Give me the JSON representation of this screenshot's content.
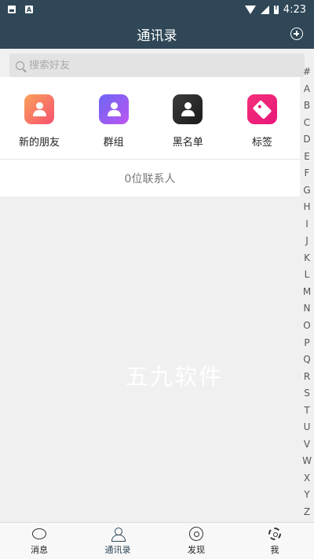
{
  "status_bar": {
    "left_icons": [
      "image-icon",
      "a-icon"
    ],
    "right_icons": [
      "wifi-icon",
      "signal-icon",
      "battery-alert-icon"
    ],
    "time": "4:23"
  },
  "header": {
    "title": "通讯录",
    "action_icon": "add-circle-icon"
  },
  "search": {
    "placeholder": "搜索好友",
    "value": ""
  },
  "shortcuts": [
    {
      "label": "新的朋友",
      "icon": "new-friend-icon"
    },
    {
      "label": "群组",
      "icon": "group-icon"
    },
    {
      "label": "黑名单",
      "icon": "blacklist-icon"
    },
    {
      "label": "标签",
      "icon": "tag-icon"
    }
  ],
  "contacts": {
    "count_text": "0位联系人"
  },
  "watermark": "五九软件",
  "index_letters": [
    "#",
    "A",
    "B",
    "C",
    "D",
    "E",
    "F",
    "G",
    "H",
    "I",
    "J",
    "K",
    "L",
    "M",
    "N",
    "O",
    "P",
    "Q",
    "R",
    "S",
    "T",
    "U",
    "V",
    "W",
    "X",
    "Y",
    "Z"
  ],
  "bottom_nav": [
    {
      "label": "消息",
      "icon": "message-icon"
    },
    {
      "label": "通讯录",
      "icon": "contacts-icon",
      "active": true
    },
    {
      "label": "发现",
      "icon": "discover-icon"
    },
    {
      "label": "我",
      "icon": "settings-icon"
    }
  ],
  "colors": {
    "header_bg": "#2f4757",
    "background": "#f0f0f0"
  }
}
